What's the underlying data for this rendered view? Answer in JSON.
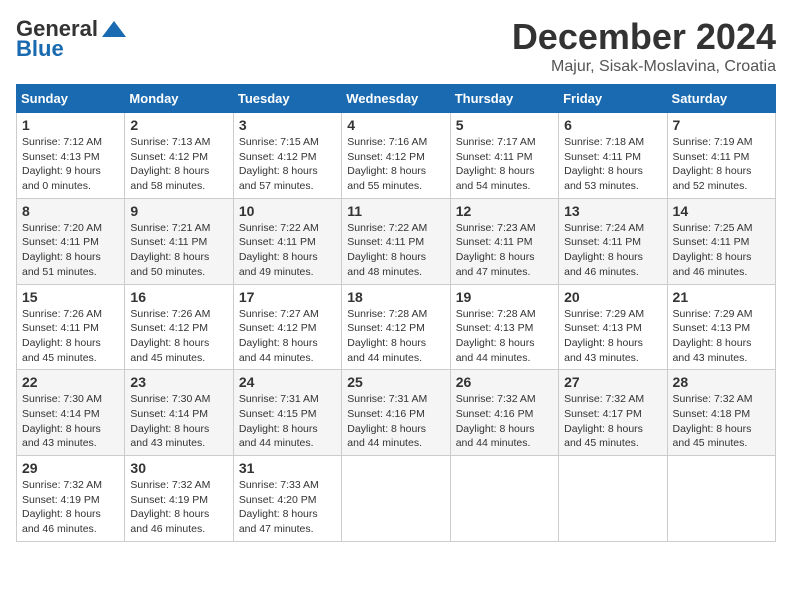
{
  "header": {
    "logo_general": "General",
    "logo_blue": "Blue",
    "month_title": "December 2024",
    "location": "Majur, Sisak-Moslavina, Croatia"
  },
  "days_of_week": [
    "Sunday",
    "Monday",
    "Tuesday",
    "Wednesday",
    "Thursday",
    "Friday",
    "Saturday"
  ],
  "weeks": [
    [
      {
        "day": "1",
        "sunrise": "7:12 AM",
        "sunset": "4:13 PM",
        "daylight": "9 hours and 0 minutes."
      },
      {
        "day": "2",
        "sunrise": "7:13 AM",
        "sunset": "4:12 PM",
        "daylight": "8 hours and 58 minutes."
      },
      {
        "day": "3",
        "sunrise": "7:15 AM",
        "sunset": "4:12 PM",
        "daylight": "8 hours and 57 minutes."
      },
      {
        "day": "4",
        "sunrise": "7:16 AM",
        "sunset": "4:12 PM",
        "daylight": "8 hours and 55 minutes."
      },
      {
        "day": "5",
        "sunrise": "7:17 AM",
        "sunset": "4:11 PM",
        "daylight": "8 hours and 54 minutes."
      },
      {
        "day": "6",
        "sunrise": "7:18 AM",
        "sunset": "4:11 PM",
        "daylight": "8 hours and 53 minutes."
      },
      {
        "day": "7",
        "sunrise": "7:19 AM",
        "sunset": "4:11 PM",
        "daylight": "8 hours and 52 minutes."
      }
    ],
    [
      {
        "day": "8",
        "sunrise": "7:20 AM",
        "sunset": "4:11 PM",
        "daylight": "8 hours and 51 minutes."
      },
      {
        "day": "9",
        "sunrise": "7:21 AM",
        "sunset": "4:11 PM",
        "daylight": "8 hours and 50 minutes."
      },
      {
        "day": "10",
        "sunrise": "7:22 AM",
        "sunset": "4:11 PM",
        "daylight": "8 hours and 49 minutes."
      },
      {
        "day": "11",
        "sunrise": "7:22 AM",
        "sunset": "4:11 PM",
        "daylight": "8 hours and 48 minutes."
      },
      {
        "day": "12",
        "sunrise": "7:23 AM",
        "sunset": "4:11 PM",
        "daylight": "8 hours and 47 minutes."
      },
      {
        "day": "13",
        "sunrise": "7:24 AM",
        "sunset": "4:11 PM",
        "daylight": "8 hours and 46 minutes."
      },
      {
        "day": "14",
        "sunrise": "7:25 AM",
        "sunset": "4:11 PM",
        "daylight": "8 hours and 46 minutes."
      }
    ],
    [
      {
        "day": "15",
        "sunrise": "7:26 AM",
        "sunset": "4:11 PM",
        "daylight": "8 hours and 45 minutes."
      },
      {
        "day": "16",
        "sunrise": "7:26 AM",
        "sunset": "4:12 PM",
        "daylight": "8 hours and 45 minutes."
      },
      {
        "day": "17",
        "sunrise": "7:27 AM",
        "sunset": "4:12 PM",
        "daylight": "8 hours and 44 minutes."
      },
      {
        "day": "18",
        "sunrise": "7:28 AM",
        "sunset": "4:12 PM",
        "daylight": "8 hours and 44 minutes."
      },
      {
        "day": "19",
        "sunrise": "7:28 AM",
        "sunset": "4:13 PM",
        "daylight": "8 hours and 44 minutes."
      },
      {
        "day": "20",
        "sunrise": "7:29 AM",
        "sunset": "4:13 PM",
        "daylight": "8 hours and 43 minutes."
      },
      {
        "day": "21",
        "sunrise": "7:29 AM",
        "sunset": "4:13 PM",
        "daylight": "8 hours and 43 minutes."
      }
    ],
    [
      {
        "day": "22",
        "sunrise": "7:30 AM",
        "sunset": "4:14 PM",
        "daylight": "8 hours and 43 minutes."
      },
      {
        "day": "23",
        "sunrise": "7:30 AM",
        "sunset": "4:14 PM",
        "daylight": "8 hours and 43 minutes."
      },
      {
        "day": "24",
        "sunrise": "7:31 AM",
        "sunset": "4:15 PM",
        "daylight": "8 hours and 44 minutes."
      },
      {
        "day": "25",
        "sunrise": "7:31 AM",
        "sunset": "4:16 PM",
        "daylight": "8 hours and 44 minutes."
      },
      {
        "day": "26",
        "sunrise": "7:32 AM",
        "sunset": "4:16 PM",
        "daylight": "8 hours and 44 minutes."
      },
      {
        "day": "27",
        "sunrise": "7:32 AM",
        "sunset": "4:17 PM",
        "daylight": "8 hours and 45 minutes."
      },
      {
        "day": "28",
        "sunrise": "7:32 AM",
        "sunset": "4:18 PM",
        "daylight": "8 hours and 45 minutes."
      }
    ],
    [
      {
        "day": "29",
        "sunrise": "7:32 AM",
        "sunset": "4:19 PM",
        "daylight": "8 hours and 46 minutes."
      },
      {
        "day": "30",
        "sunrise": "7:32 AM",
        "sunset": "4:19 PM",
        "daylight": "8 hours and 46 minutes."
      },
      {
        "day": "31",
        "sunrise": "7:33 AM",
        "sunset": "4:20 PM",
        "daylight": "8 hours and 47 minutes."
      },
      null,
      null,
      null,
      null
    ]
  ]
}
